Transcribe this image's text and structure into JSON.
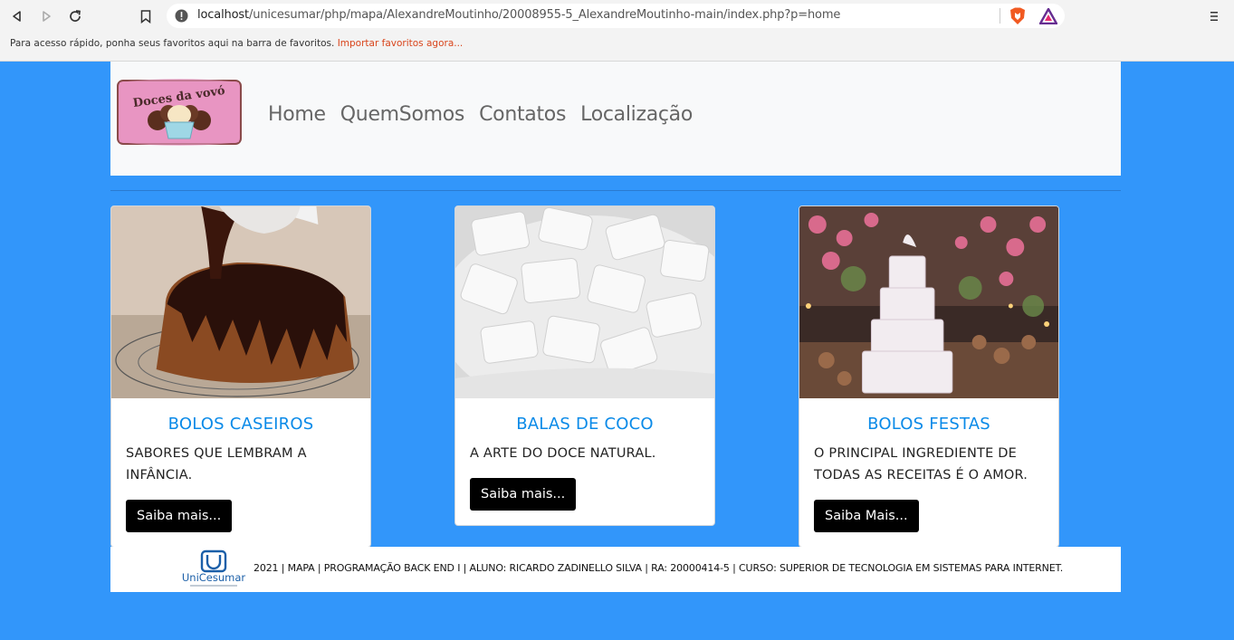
{
  "browser": {
    "url_host": "localhost",
    "url_path": "/unicesumar/php/mapa/AlexandreMoutinho/20008955-5_AlexandreMoutinho-main/index.php?p=home",
    "bookmarks_text": "Para acesso rápido, ponha seus favoritos aqui na barra de favoritos.",
    "bookmarks_link": "Importar favoritos agora...",
    "icons": [
      "back-icon",
      "forward-icon",
      "reload-icon",
      "bookmark-icon",
      "info-icon",
      "brave-shield-icon",
      "brave-rewards-icon",
      "menu-icon"
    ]
  },
  "site": {
    "logo_text": "Doces da vovó",
    "menu": [
      "Home",
      "QuemSomos",
      "Contatos",
      "Localização"
    ]
  },
  "cards": [
    {
      "title": "BOLOS CASEIROS",
      "text": "SABORES QUE LEMBRAM A INFÂNCIA.",
      "button": "Saiba mais..."
    },
    {
      "title": "BALAS DE COCO",
      "text": "A ARTE DO DOCE NATURAL.",
      "button": "Saiba mais..."
    },
    {
      "title": "BOLOS FESTAS",
      "text": "O PRINCIPAL INGREDIENTE DE TODAS AS RECEITAS É O AMOR.",
      "button": "Saiba Mais..."
    }
  ],
  "footer": {
    "logo_text": "UniCesumar",
    "text": "2021 | MAPA | PROGRAMAÇÃO BACK END I | ALUNO: RICARDO ZADINELLO SILVA | RA: 20000414-5 | CURSO: SUPERIOR DE TECNOLOGIA EM SISTEMAS PARA INTERNET."
  },
  "colors": {
    "page_bg": "#3296fa",
    "card_title": "#0a8ae8",
    "button_bg": "#000000"
  }
}
